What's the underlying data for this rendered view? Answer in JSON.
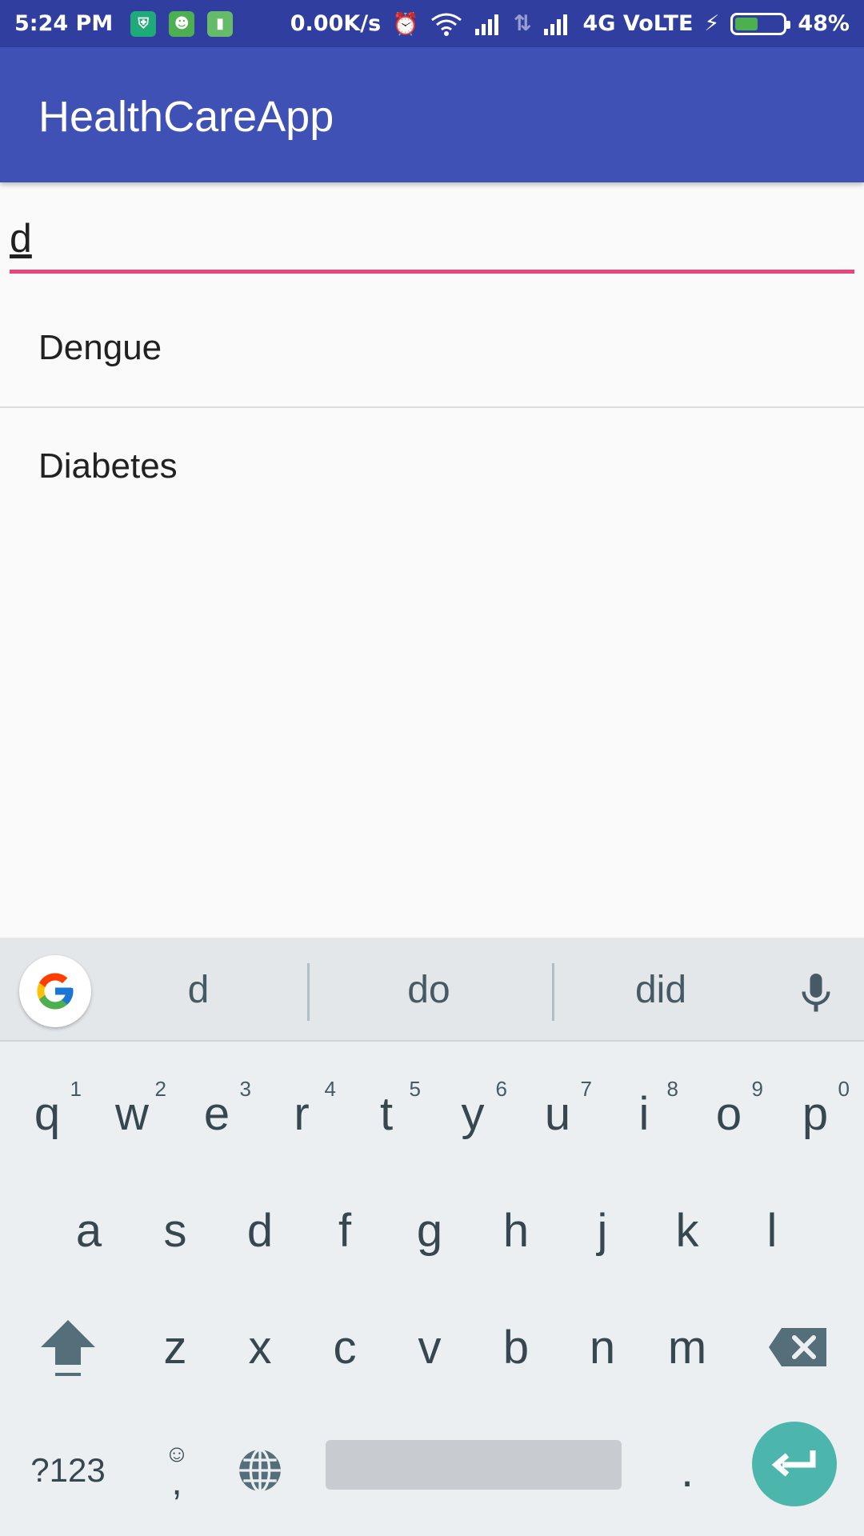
{
  "status_bar": {
    "time": "5:24 PM",
    "speed": "0.00K/s",
    "network": "4G VoLTE",
    "battery": "48%",
    "battery_fraction": 0.48,
    "colors": {
      "bg": "#303f9f",
      "battery_fill": "#4caf50"
    }
  },
  "app_bar": {
    "title": "HealthCareApp",
    "color": "#3f51b5"
  },
  "search": {
    "value": "d",
    "accent": "#e8457f"
  },
  "results": [
    {
      "label": "Dengue"
    },
    {
      "label": "Diabetes"
    }
  ],
  "keyboard": {
    "suggestions": [
      "d",
      "do",
      "did"
    ],
    "row1": [
      {
        "key": "q",
        "num": "1"
      },
      {
        "key": "w",
        "num": "2"
      },
      {
        "key": "e",
        "num": "3"
      },
      {
        "key": "r",
        "num": "4"
      },
      {
        "key": "t",
        "num": "5"
      },
      {
        "key": "y",
        "num": "6"
      },
      {
        "key": "u",
        "num": "7"
      },
      {
        "key": "i",
        "num": "8"
      },
      {
        "key": "o",
        "num": "9"
      },
      {
        "key": "p",
        "num": "0"
      }
    ],
    "row2": [
      "a",
      "s",
      "d",
      "f",
      "g",
      "h",
      "j",
      "k",
      "l"
    ],
    "row3": [
      "z",
      "x",
      "c",
      "v",
      "b",
      "n",
      "m"
    ],
    "symbols_label": "?123",
    "emoji_comma": ",",
    "period": ".",
    "enter_color": "#4db6ac"
  }
}
